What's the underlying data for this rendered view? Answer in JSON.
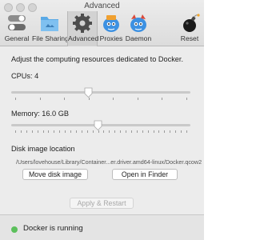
{
  "window": {
    "title": "Advanced"
  },
  "toolbar": {
    "items": [
      {
        "label": "General",
        "icon": "toggle-icon"
      },
      {
        "label": "File Sharing",
        "icon": "folder-icon"
      },
      {
        "label": "Advanced",
        "icon": "gear-icon",
        "selected": true
      },
      {
        "label": "Proxies",
        "icon": "docker-proxies-icon"
      },
      {
        "label": "Daemon",
        "icon": "docker-daemon-icon"
      },
      {
        "label": "Reset",
        "icon": "bomb-icon"
      }
    ]
  },
  "main": {
    "description": "Adjust the computing resources dedicated to Docker.",
    "cpus": {
      "label": "CPUs: 4",
      "value": 4,
      "min": 1,
      "max": 8
    },
    "memory": {
      "label": "Memory: 16.0 GB",
      "value": 16,
      "min": 1,
      "max": 32
    },
    "disk": {
      "heading": "Disk image location",
      "path": "/Users/lovehouse/Library/Container...er.driver.amd64-linux/Docker.qcow2"
    },
    "buttons": {
      "move": "Move disk image",
      "open": "Open in Finder",
      "apply": "Apply & Restart"
    }
  },
  "status": {
    "text": "Docker is running",
    "color": "#5cc05c"
  },
  "colors": {
    "accent": "#3d91e2",
    "status_running": "#5cc05c"
  }
}
